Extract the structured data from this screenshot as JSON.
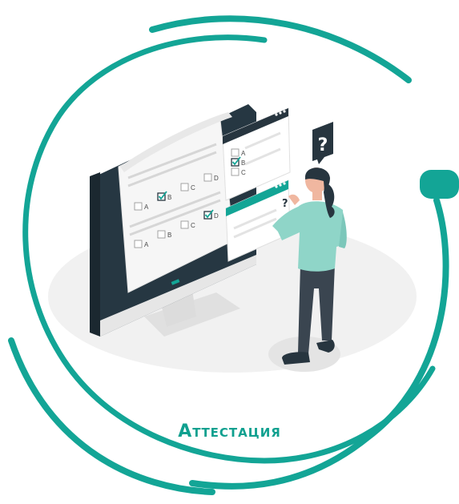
{
  "title": "Аттестация",
  "colors": {
    "accent": "#13a596",
    "dark": "#27353f",
    "teal_light": "#8fd5c8"
  },
  "worksheet": {
    "row1": [
      "A",
      "B",
      "C",
      "D"
    ],
    "row2": [
      "A",
      "B",
      "C",
      "D"
    ],
    "checked_row1": "B",
    "checked_row2": "D"
  },
  "popup1": {
    "options": [
      "A",
      "B",
      "C"
    ],
    "checked": "B"
  },
  "icons": [
    "question-mark-bubble-icon",
    "question-mark-icon",
    "checkbox-checked-icon"
  ]
}
